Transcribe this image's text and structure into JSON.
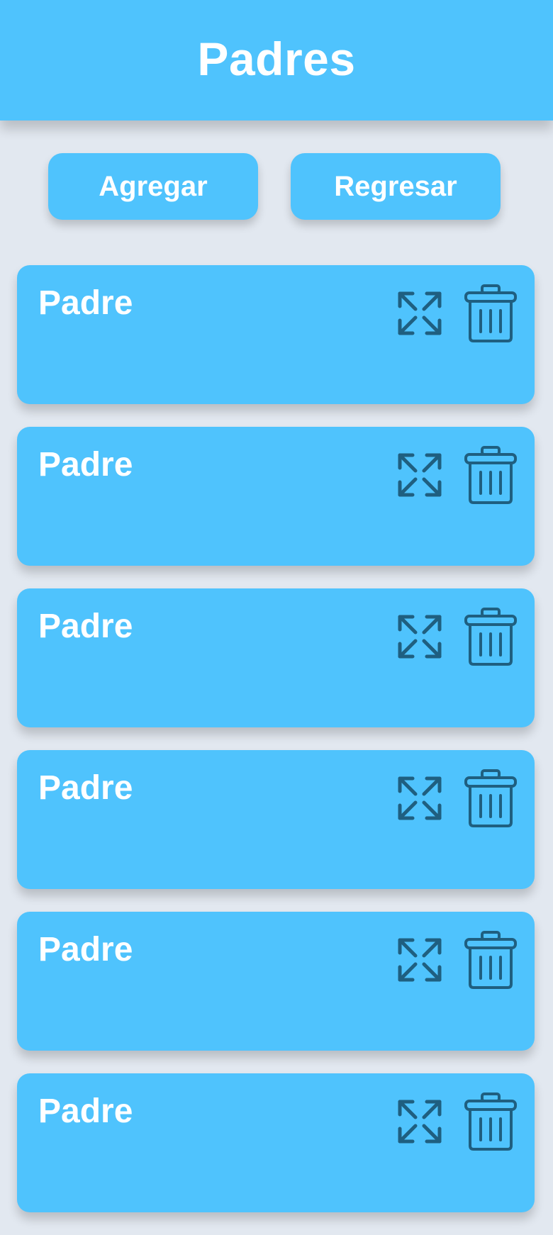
{
  "header": {
    "title": "Padres"
  },
  "actions": {
    "add_label": "Agregar",
    "back_label": "Regresar"
  },
  "list": {
    "items": [
      {
        "title": "Padre"
      },
      {
        "title": "Padre"
      },
      {
        "title": "Padre"
      },
      {
        "title": "Padre"
      },
      {
        "title": "Padre"
      },
      {
        "title": "Padre"
      }
    ]
  },
  "icons": {
    "expand": "expand-icon",
    "delete": "trash-icon"
  },
  "colors": {
    "background": "#e2e8f0",
    "primary": "#4fc3fd",
    "text_on_primary": "#ffffff",
    "icon": "#1f5f80"
  }
}
